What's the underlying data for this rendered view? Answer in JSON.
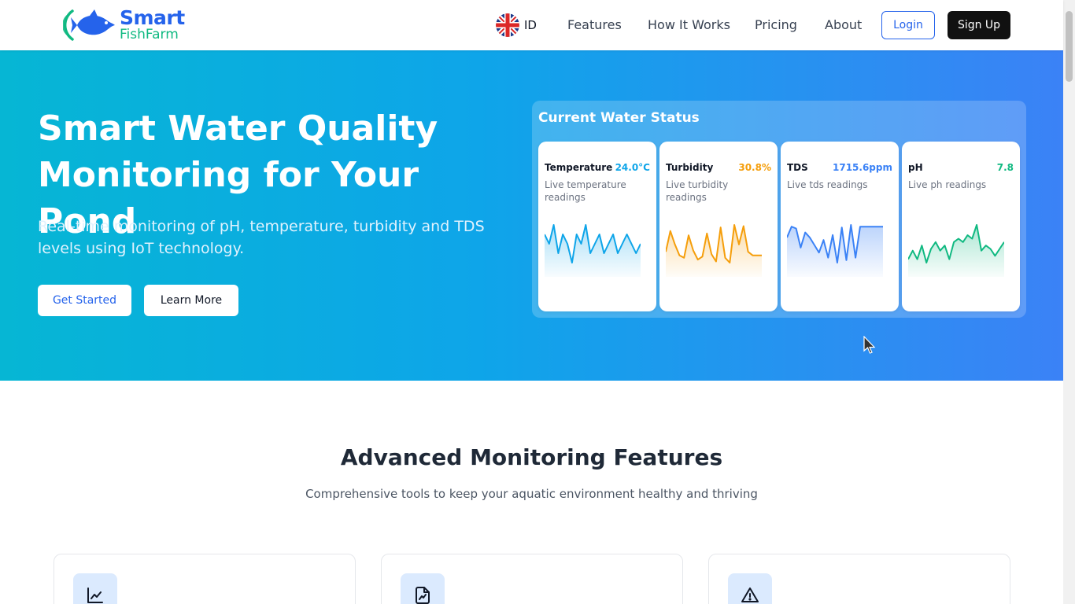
{
  "brand": {
    "name_line1": "Smart",
    "name_line2": "FishFarm"
  },
  "nav": {
    "language": "ID",
    "links": [
      "Features",
      "How It Works",
      "Pricing",
      "About"
    ],
    "login": "Login",
    "signup": "Sign Up"
  },
  "hero": {
    "title": "Smart Water Quality Monitoring for Your Pond",
    "subtitle": "Real-time monitoring of pH, temperature, turbidity and TDS levels using IoT technology.",
    "primary_button": "Get Started",
    "secondary_button": "Learn More"
  },
  "status": {
    "title": "Current Water Status",
    "cards": [
      {
        "name": "Temperature",
        "value": "24.0°C",
        "desc": "Live temperature readings",
        "color": "#0ea5e9",
        "series": [
          24.1,
          24.0,
          24.2,
          23.9,
          24.1,
          24.0,
          23.8,
          24.1,
          24.0,
          24.2,
          23.9,
          24.0,
          24.1,
          23.9,
          24.0,
          24.1,
          23.9,
          24.0,
          24.1,
          24.0,
          23.9,
          24.0
        ]
      },
      {
        "name": "Turbidity",
        "value": "30.8%",
        "desc": "Live turbidity readings",
        "color": "#f59e0b",
        "series": [
          28,
          62,
          40,
          22,
          18,
          55,
          30,
          15,
          20,
          58,
          24,
          12,
          68,
          18,
          10,
          72,
          40,
          70,
          28,
          22,
          22,
          22
        ]
      },
      {
        "name": "TDS",
        "value": "1715.6ppm",
        "desc": "Live tds readings",
        "color": "#3b82f6",
        "series": [
          1500,
          1715,
          1680,
          1300,
          1600,
          1500,
          1350,
          1200,
          1450,
          1100,
          1550,
          1000,
          1700,
          1050,
          1750,
          1100,
          1715,
          1715,
          1715,
          1715,
          1715,
          1715
        ]
      },
      {
        "name": "pH",
        "value": "7.8",
        "desc": "Live ph readings",
        "color": "#10b981",
        "series": [
          7.6,
          7.65,
          7.6,
          7.68,
          7.58,
          7.66,
          7.7,
          7.65,
          7.68,
          7.6,
          7.7,
          7.72,
          7.7,
          7.74,
          7.72,
          7.8,
          7.65,
          7.68,
          7.66,
          7.62,
          7.66,
          7.7
        ]
      }
    ]
  },
  "features": {
    "title": "Advanced Monitoring Features",
    "subtitle": "Comprehensive tools to keep your aquatic environment healthy and thriving",
    "icons": [
      "line-chart-icon",
      "document-chart-icon",
      "warning-icon"
    ]
  },
  "colors": {
    "primary": "#2563eb",
    "accent": "#10b981",
    "hero_from": "#06b6d4",
    "hero_to": "#3b82f6"
  }
}
